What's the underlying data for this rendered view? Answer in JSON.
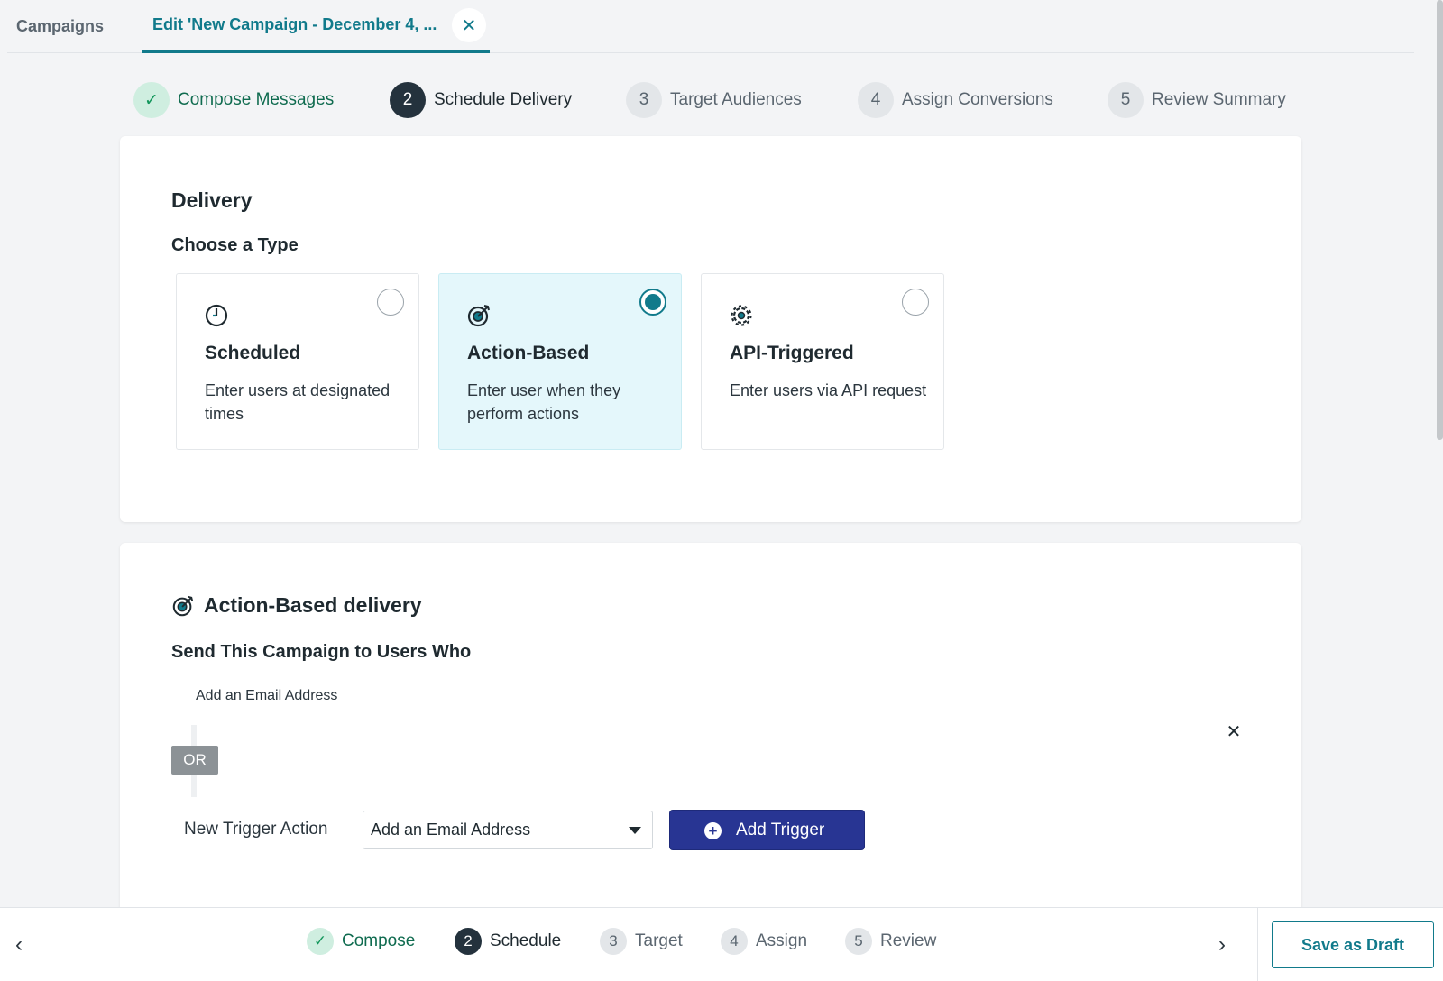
{
  "tabs": {
    "campaigns": "Campaigns",
    "edit": "Edit 'New Campaign - December 4, ..."
  },
  "steps": [
    {
      "num": "✓",
      "label": "Compose Messages",
      "state": "done"
    },
    {
      "num": "2",
      "label": "Schedule Delivery",
      "state": "active"
    },
    {
      "num": "3",
      "label": "Target Audiences",
      "state": "pending"
    },
    {
      "num": "4",
      "label": "Assign Conversions",
      "state": "pending"
    },
    {
      "num": "5",
      "label": "Review Summary",
      "state": "pending"
    }
  ],
  "delivery": {
    "title": "Delivery",
    "choose": "Choose a Type",
    "types": [
      {
        "icon": "clock-icon",
        "title": "Scheduled",
        "desc": "Enter users at designated times",
        "selected": false
      },
      {
        "icon": "target-icon",
        "title": "Action-Based",
        "desc": "Enter user when they perform actions",
        "selected": true
      },
      {
        "icon": "gear-icon",
        "title": "API-Triggered",
        "desc": "Enter users via API request",
        "selected": false
      }
    ]
  },
  "action_based": {
    "title": "Action-Based delivery",
    "send_to": "Send This Campaign to Users Who",
    "trigger": "Add an Email Address",
    "or": "OR",
    "new_trigger_label": "New Trigger Action",
    "new_trigger_value": "Add an Email Address",
    "add_trigger": "Add Trigger"
  },
  "footer": {
    "steps": [
      {
        "num": "✓",
        "label": "Compose",
        "state": "done"
      },
      {
        "num": "2",
        "label": "Schedule",
        "state": "active"
      },
      {
        "num": "3",
        "label": "Target",
        "state": "pending"
      },
      {
        "num": "4",
        "label": "Assign",
        "state": "pending"
      },
      {
        "num": "5",
        "label": "Review",
        "state": "pending"
      }
    ],
    "prev": "‹",
    "next": "›",
    "save_draft": "Save as Draft"
  },
  "colors": {
    "accent": "#117a8b",
    "primary_button": "#283593",
    "done_green": "#14975c"
  }
}
